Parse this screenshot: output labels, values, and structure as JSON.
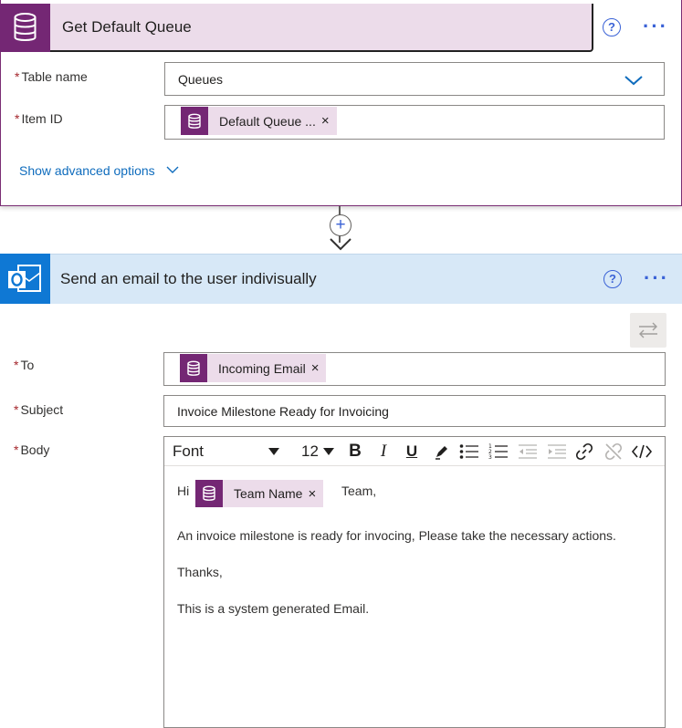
{
  "action1": {
    "title": "Get Default Queue",
    "help_icon": "?",
    "more_icon": "···",
    "table_label": "Table name",
    "table_value": "Queues",
    "item_label": "Item ID",
    "item_token": "Default Queue ...",
    "token_remove": "×",
    "advanced_link": "Show advanced options"
  },
  "connector": {
    "plus": "+"
  },
  "action2": {
    "title": "Send an email to the user indivisually",
    "help_icon": "?",
    "more_icon": "···",
    "to_label": "To",
    "to_token": "Incoming Email",
    "subject_label": "Subject",
    "subject_value": "Invoice Milestone Ready for Invoicing",
    "body_label": "Body",
    "toolbar": {
      "font": "Font",
      "font_size": "12",
      "bold": "B",
      "italic": "I",
      "underline": "U"
    },
    "body": {
      "greeting_prefix": "Hi",
      "team_token": "Team Name",
      "greeting_suffix": "Team,",
      "line1": "An invoice milestone is ready for invocing, Please take the necessary actions.",
      "line2": "Thanks,",
      "line3": "This is a system generated Email."
    }
  },
  "required_marker": "*",
  "colors": {
    "dataverse_purple": "#742774",
    "outlook_blue": "#0f78d4",
    "link_blue": "#0f6cbd",
    "required_red": "#a4262c"
  }
}
